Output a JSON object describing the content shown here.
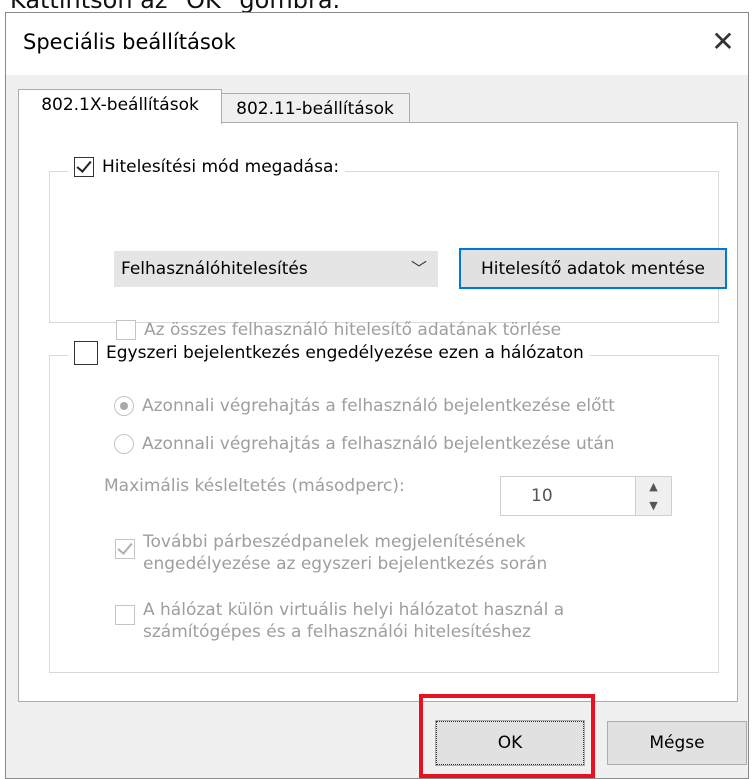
{
  "caption": "Kattintson az \"OK\" gombra.",
  "dialog": {
    "title": "Speciális beállítások",
    "close_icon": "close-icon"
  },
  "tabs": [
    {
      "label": "802.1X-beállítások",
      "active": true
    },
    {
      "label": "802.11-beállítások",
      "active": false
    }
  ],
  "auth": {
    "checkbox_label": "Hitelesítési mód megadása:",
    "checked": true,
    "mode_value": "Felhasználóhitelesítés",
    "save_button": "Hitelesítő adatok mentése",
    "delete_label": "Az összes felhasználó hitelesítő adatának törlése"
  },
  "sso": {
    "checkbox_label": "Egyszeri bejelentkezés engedélyezése ezen a hálózaton",
    "checked": false,
    "radio_before": "Azonnali végrehajtás a felhasználó bejelentkezése előtt",
    "radio_after": "Azonnali végrehajtás a felhasználó bejelentkezése után",
    "max_delay_label": "Maximális késleltetés (másodperc):",
    "max_delay_value": "10",
    "extra_dialogs_line1": "További párbeszédpanelek megjelenítésének",
    "extra_dialogs_line2": "engedélyezése az egyszeri bejelentkezés során",
    "vlan_line1": "A hálózat külön virtuális helyi hálózatot használ a",
    "vlan_line2": "számítógépes és a felhasználói hitelesítéshez"
  },
  "buttons": {
    "ok": "OK",
    "cancel": "Mégse"
  },
  "colors": {
    "highlight": "#e81123",
    "focus_blue": "#0078d7"
  }
}
